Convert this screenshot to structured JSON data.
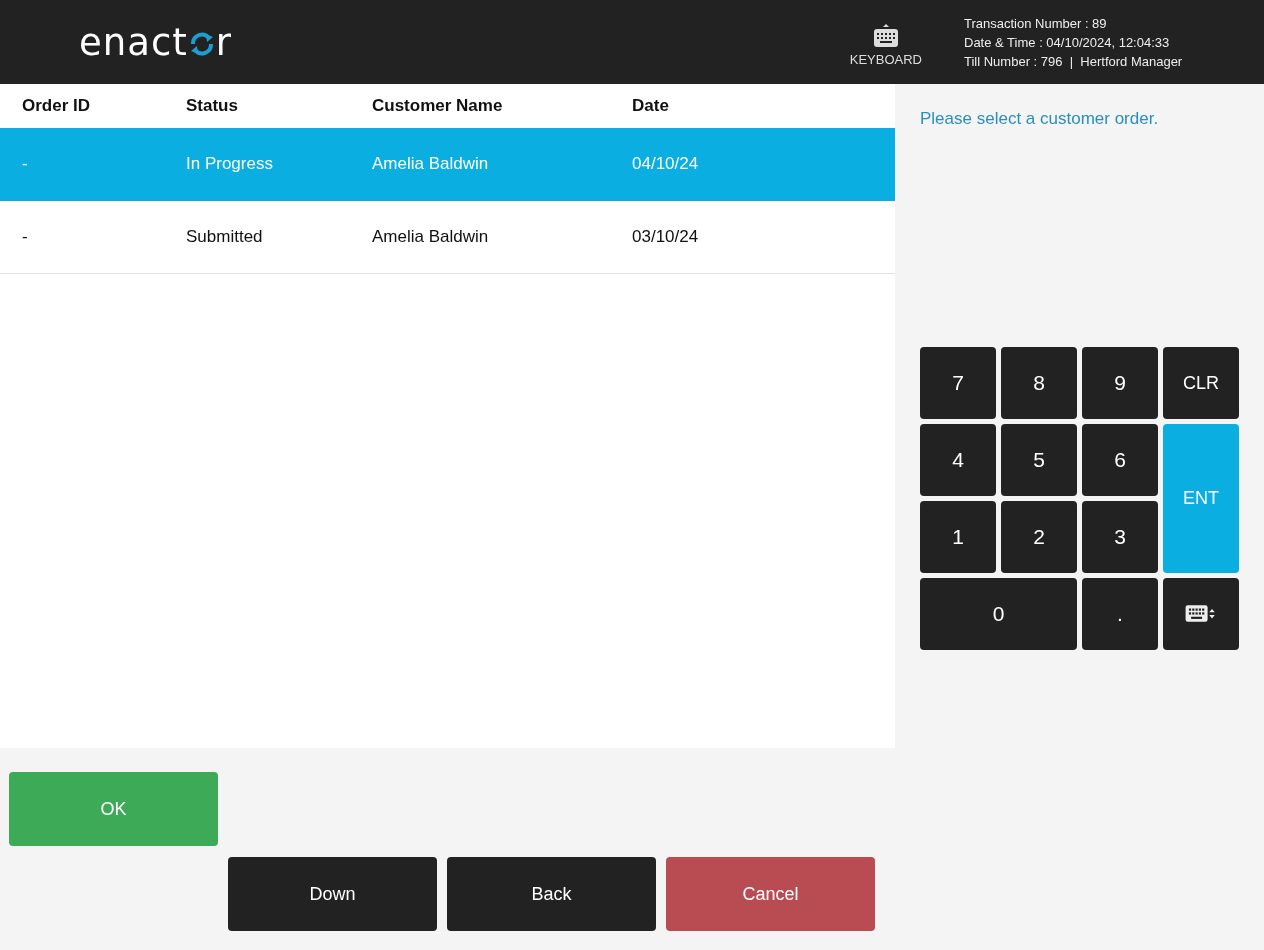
{
  "header": {
    "logo": {
      "before": "enact",
      "after": "r"
    },
    "keyboard_label": "KEYBOARD",
    "info": [
      "Transaction Number : 89",
      "Date & Time : 04/10/2024, 12:04:33",
      "Till Number : 796  |  Hertford Manager"
    ]
  },
  "table": {
    "columns": [
      "Order ID",
      "Status",
      "Customer Name",
      "Date"
    ],
    "rows": [
      {
        "cells": [
          "-",
          "In Progress",
          "Amelia Baldwin",
          "04/10/24"
        ],
        "selected": true
      },
      {
        "cells": [
          "-",
          "Submitted",
          "Amelia Baldwin",
          "03/10/24"
        ],
        "selected": false
      }
    ]
  },
  "message": "Please select a customer order.",
  "keypad": [
    {
      "kind": "digit",
      "label": "7"
    },
    {
      "kind": "digit",
      "label": "8"
    },
    {
      "kind": "digit",
      "label": "9"
    },
    {
      "kind": "clear",
      "label": "CLR"
    },
    {
      "kind": "digit",
      "label": "4"
    },
    {
      "kind": "digit",
      "label": "5"
    },
    {
      "kind": "digit",
      "label": "6"
    },
    {
      "kind": "enter",
      "label": "ENT"
    },
    {
      "kind": "digit",
      "label": "1"
    },
    {
      "kind": "digit",
      "label": "2"
    },
    {
      "kind": "digit",
      "label": "3"
    },
    {
      "kind": "wide",
      "label": "0"
    },
    {
      "kind": "digit",
      "label": "."
    },
    {
      "kind": "keyboard"
    }
  ],
  "actions": [
    {
      "kind": "ok",
      "label": "OK"
    },
    {
      "kind": "default",
      "label": "Down"
    },
    {
      "kind": "default",
      "label": "Back"
    },
    {
      "kind": "cancel",
      "label": "Cancel"
    }
  ]
}
